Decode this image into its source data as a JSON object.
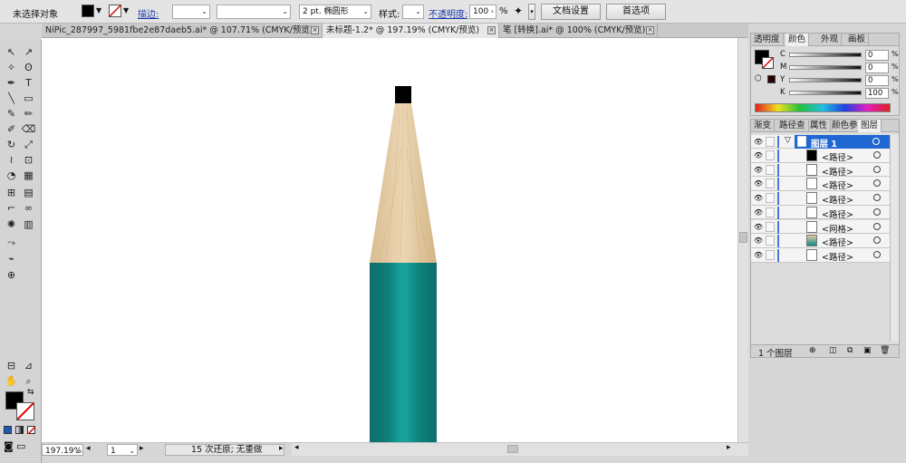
{
  "control_bar": {
    "selection_label": "未选择对象",
    "stroke_label": "描边:",
    "stroke_weight": "",
    "brush_value": "2 pt. 椭圆形",
    "style_label": "样式:",
    "opacity_label": "不透明度:",
    "opacity_value": "100",
    "opacity_unit": "%",
    "doc_setup_button": "文档设置",
    "preferences_button": "首选项"
  },
  "tabs": [
    {
      "label": "NiPic_287997_5981fbe2e87daeb5.ai* @ 107.71% (CMYK/预览)",
      "active": false
    },
    {
      "label": "未标题-1.2* @ 197.19% (CMYK/预览)",
      "active": true
    },
    {
      "label": "笔 [转换].ai* @ 100% (CMYK/预览)",
      "active": false
    }
  ],
  "toolbox": {
    "tools": [
      [
        "selection-tool",
        "direct-selection-tool"
      ],
      [
        "magic-wand-tool",
        "lasso-tool"
      ],
      [
        "pen-tool",
        "type-tool"
      ],
      [
        "line-tool",
        "rectangle-tool"
      ],
      [
        "paintbrush-tool",
        "pencil-tool"
      ],
      [
        "blob-brush-tool",
        "eraser-tool"
      ],
      [
        "rotate-tool",
        "scale-tool"
      ],
      [
        "warp-tool",
        "free-transform-tool"
      ],
      [
        "shape-builder-tool",
        "perspective-grid-tool"
      ],
      [
        "mesh-tool",
        "gradient-tool"
      ],
      [
        "eyedropper-tool",
        "blend-tool"
      ],
      [
        "symbol-sprayer-tool",
        "column-graph-tool"
      ],
      [
        "artboard-tool",
        "slice-tool"
      ],
      [
        "hand-tool",
        "zoom-tool"
      ]
    ]
  },
  "colors": {
    "canvas": "#ffffff",
    "pencil_wood": "#e3c9a2",
    "pencil_body": "#118a85",
    "pencil_tip": "#000000",
    "fill": "#000000",
    "layer_highlight": "#1f67d2",
    "layer_bar": "#4a74e0"
  },
  "color_panel": {
    "tabs": [
      "透明度",
      "颜色",
      "外观",
      "画板"
    ],
    "active_tab": 1,
    "channels": [
      {
        "label": "C",
        "value": "0"
      },
      {
        "label": "M",
        "value": "0"
      },
      {
        "label": "Y",
        "value": "0"
      },
      {
        "label": "K",
        "value": "100"
      }
    ],
    "unit": "%"
  },
  "layers_panel": {
    "tabs": [
      "渐变",
      "路径查",
      "属性",
      "颜色参",
      "图层"
    ],
    "active_tab": 4,
    "layer_name": "图层 1",
    "items": [
      {
        "name": "<路径>",
        "thumb": "black"
      },
      {
        "name": "<路径>",
        "thumb": "white"
      },
      {
        "name": "<路径>",
        "thumb": "white"
      },
      {
        "name": "<路径>",
        "thumb": "white"
      },
      {
        "name": "<路径>",
        "thumb": "white"
      },
      {
        "name": "<网格>",
        "thumb": "white"
      },
      {
        "name": "<路径>",
        "thumb": "pencil"
      },
      {
        "name": "<路径>",
        "thumb": "white"
      }
    ],
    "footer_count": "1 个图层"
  },
  "status": {
    "zoom": "197.19%",
    "artboard": "1",
    "history": "15 次还原; 无重做"
  }
}
